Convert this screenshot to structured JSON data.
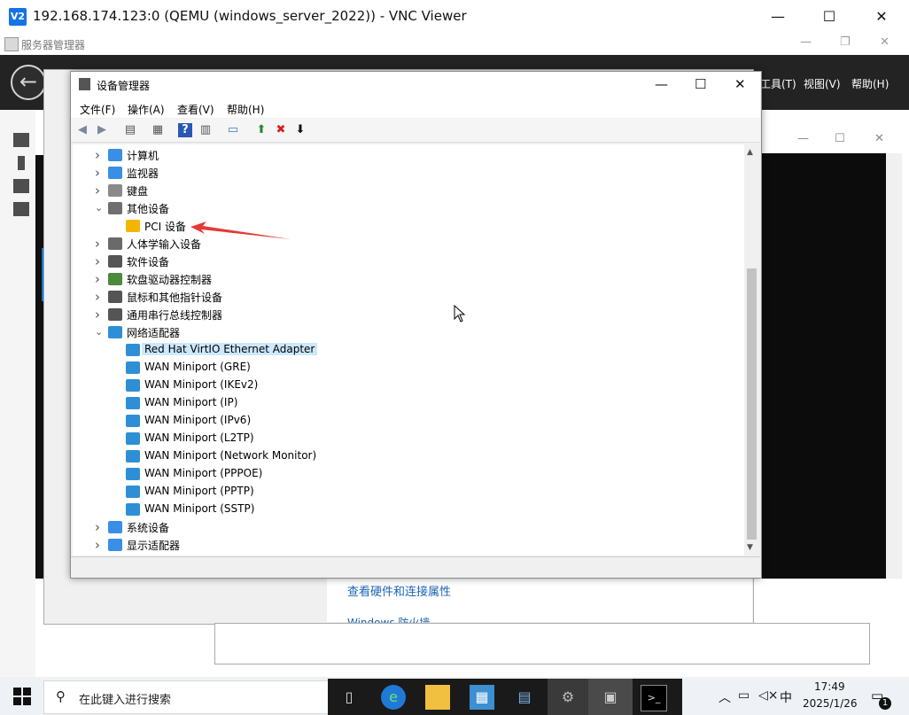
{
  "vnc": {
    "title": "192.168.174.123:0 (QEMU (windows_server_2022)) - VNC Viewer",
    "logo": "V2",
    "minimize": "—",
    "maximize": "☐",
    "close": "✕"
  },
  "server_manager": {
    "title": "服务器管理器",
    "menus": [
      "工具(T)",
      "视图(V)",
      "帮助(H)"
    ],
    "links": [
      "查看硬件和连接属性",
      "Windows 防火墙"
    ]
  },
  "device_manager": {
    "title": "设备管理器",
    "menu": [
      "文件(F)",
      "操作(A)",
      "查看(V)",
      "帮助(H)"
    ],
    "tree": [
      {
        "label": "计算机",
        "expanded": false,
        "level": 0,
        "icon": "computer-icon"
      },
      {
        "label": "监视器",
        "expanded": false,
        "level": 0,
        "icon": "monitor-icon"
      },
      {
        "label": "键盘",
        "expanded": false,
        "level": 0,
        "icon": "keyboard-icon"
      },
      {
        "label": "其他设备",
        "expanded": true,
        "level": 0,
        "icon": "unknown-device-icon"
      },
      {
        "label": "PCI 设备",
        "level": 1,
        "icon": "warning-device-icon"
      },
      {
        "label": "人体学输入设备",
        "expanded": false,
        "level": 0,
        "icon": "hid-icon"
      },
      {
        "label": "软件设备",
        "expanded": false,
        "level": 0,
        "icon": "software-device-icon"
      },
      {
        "label": "软盘驱动器控制器",
        "expanded": false,
        "level": 0,
        "icon": "floppy-controller-icon"
      },
      {
        "label": "鼠标和其他指针设备",
        "expanded": false,
        "level": 0,
        "icon": "mouse-icon"
      },
      {
        "label": "通用串行总线控制器",
        "expanded": false,
        "level": 0,
        "icon": "usb-icon"
      },
      {
        "label": "网络适配器",
        "expanded": true,
        "level": 0,
        "icon": "network-adapter-icon"
      },
      {
        "label": "Red Hat VirtIO Ethernet Adapter",
        "level": 1,
        "icon": "network-adapter-icon",
        "selected": true
      },
      {
        "label": "WAN Miniport (GRE)",
        "level": 1,
        "icon": "network-adapter-icon"
      },
      {
        "label": "WAN Miniport (IKEv2)",
        "level": 1,
        "icon": "network-adapter-icon"
      },
      {
        "label": "WAN Miniport (IP)",
        "level": 1,
        "icon": "network-adapter-icon"
      },
      {
        "label": "WAN Miniport (IPv6)",
        "level": 1,
        "icon": "network-adapter-icon"
      },
      {
        "label": "WAN Miniport (L2TP)",
        "level": 1,
        "icon": "network-adapter-icon"
      },
      {
        "label": "WAN Miniport (Network Monitor)",
        "level": 1,
        "icon": "network-adapter-icon"
      },
      {
        "label": "WAN Miniport (PPPOE)",
        "level": 1,
        "icon": "network-adapter-icon"
      },
      {
        "label": "WAN Miniport (PPTP)",
        "level": 1,
        "icon": "network-adapter-icon"
      },
      {
        "label": "WAN Miniport (SSTP)",
        "level": 1,
        "icon": "network-adapter-icon"
      },
      {
        "label": "系统设备",
        "expanded": false,
        "level": 0,
        "icon": "system-device-icon"
      },
      {
        "label": "显示适配器",
        "expanded": false,
        "level": 0,
        "icon": "display-adapter-icon"
      }
    ]
  },
  "taskbar": {
    "search_placeholder": "在此键入进行搜索",
    "time": "17:49",
    "date": "2025/1/26",
    "ime": "中",
    "notification_count": "1"
  },
  "colors": {
    "selection": "#cce8ff",
    "accent": "#0a78d7",
    "arrow": "#e53935"
  }
}
